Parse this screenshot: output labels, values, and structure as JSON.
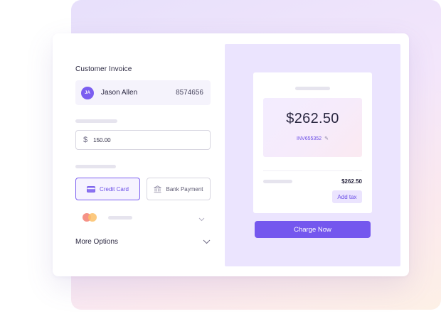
{
  "invoice_form": {
    "section_title": "Customer Invoice",
    "customer": {
      "initials": "JA",
      "name": "Jason Allen",
      "id": "8574656"
    },
    "amount": {
      "currency_symbol": "$",
      "value": "150.00"
    },
    "payment_methods": {
      "credit_card_label": "Credit Card",
      "bank_payment_label": "Bank Payment",
      "selected": "Credit Card"
    },
    "card_select": {
      "icon": "mastercard-icon"
    },
    "more_options_label": "More Options"
  },
  "preview": {
    "total": "$262.50",
    "invoice_number": "INV655352",
    "line_amount": "$262.50",
    "add_tax_label": "Add tax",
    "charge_button_label": "Charge Now"
  },
  "colors": {
    "accent": "#7457ee",
    "panel": "#ebe4fe",
    "selected_border": "#7b5ef0"
  }
}
